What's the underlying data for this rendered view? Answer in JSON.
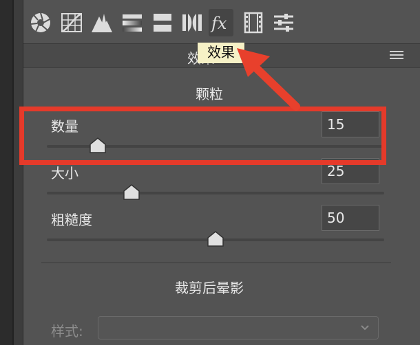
{
  "toolbar": {
    "tools": [
      {
        "icon": "aperture-icon"
      },
      {
        "icon": "tone-curve-icon"
      },
      {
        "icon": "detail-icon"
      },
      {
        "icon": "hsl-icon"
      },
      {
        "icon": "split-toning-icon"
      },
      {
        "icon": "lens-corrections-icon"
      },
      {
        "icon": "fx-effects-icon",
        "active": true
      },
      {
        "icon": "camera-calibration-icon"
      },
      {
        "icon": "presets-sliders-icon"
      }
    ]
  },
  "header": {
    "title": "效果",
    "tooltip": "效果"
  },
  "grain": {
    "title": "颗粒",
    "sliders": [
      {
        "label": "数量",
        "value": "15",
        "level": 15
      },
      {
        "label": "大小",
        "value": "25",
        "level": 25
      },
      {
        "label": "粗糙度",
        "value": "50",
        "level": 50
      }
    ]
  },
  "vignette": {
    "title": "裁剪后晕影",
    "style_label": "样式:",
    "style_value": ""
  },
  "annotation": {
    "highlight_color": "#e53a2a",
    "arrow_color": "#e8402c"
  }
}
